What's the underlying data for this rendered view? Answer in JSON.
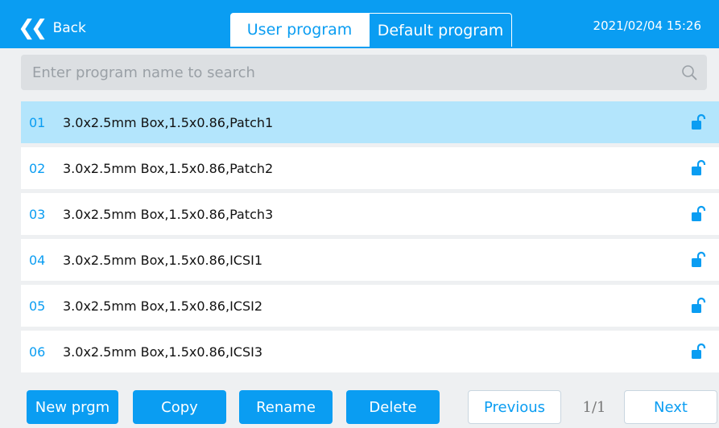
{
  "header": {
    "back_label": "Back",
    "datetime": "2021/02/04  15:26"
  },
  "tabs": [
    {
      "label": "User program",
      "active": true
    },
    {
      "label": "Default program",
      "active": false
    }
  ],
  "search": {
    "placeholder": "Enter program name to search",
    "value": ""
  },
  "programs": [
    {
      "num": "01",
      "name": "3.0x2.5mm Box,1.5x0.86,Patch1",
      "selected": true,
      "icon": "unlock-icon"
    },
    {
      "num": "02",
      "name": "3.0x2.5mm Box,1.5x0.86,Patch2",
      "selected": false,
      "icon": "unlock-icon"
    },
    {
      "num": "03",
      "name": "3.0x2.5mm Box,1.5x0.86,Patch3",
      "selected": false,
      "icon": "unlock-icon"
    },
    {
      "num": "04",
      "name": "3.0x2.5mm Box,1.5x0.86,ICSI1",
      "selected": false,
      "icon": "unlock-icon"
    },
    {
      "num": "05",
      "name": "3.0x2.5mm Box,1.5x0.86,ICSI2",
      "selected": false,
      "icon": "unlock-icon"
    },
    {
      "num": "06",
      "name": "3.0x2.5mm Box,1.5x0.86,ICSI3",
      "selected": false,
      "icon": "unlock-icon"
    }
  ],
  "actions": {
    "new_label": "New prgm",
    "copy_label": "Copy",
    "rename_label": "Rename",
    "delete_label": "Delete",
    "previous_label": "Previous",
    "page_indicator": "1/1",
    "next_label": "Next"
  },
  "colors": {
    "accent": "#0a9df2",
    "selected_row": "#b3e5fc",
    "background": "#eef0f2"
  }
}
